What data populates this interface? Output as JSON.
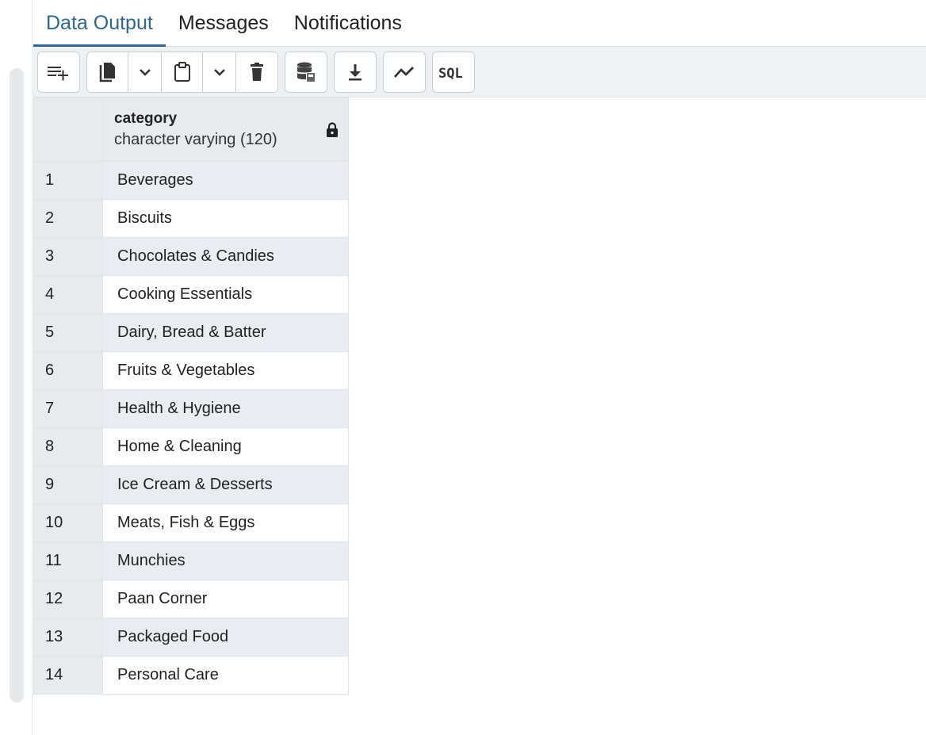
{
  "tabs": [
    {
      "label": "Data Output",
      "active": true
    },
    {
      "label": "Messages",
      "active": false
    },
    {
      "label": "Notifications",
      "active": false
    }
  ],
  "toolbar": {
    "buttons": [
      {
        "icon": "add-row-icon"
      },
      {
        "icon": "copy-icon"
      },
      {
        "icon": "chevron-down-icon"
      },
      {
        "icon": "paste-icon"
      },
      {
        "icon": "chevron-down-icon"
      },
      {
        "icon": "delete-icon"
      },
      {
        "icon": "save-data-icon"
      },
      {
        "icon": "download-icon"
      },
      {
        "icon": "graph-visualiser-icon"
      },
      {
        "icon": "sql-icon",
        "label": "SQL"
      }
    ]
  },
  "grid": {
    "column": {
      "name": "category",
      "type": "character varying (120)",
      "locked": true
    },
    "rows": [
      {
        "num": "1",
        "value": "Beverages"
      },
      {
        "num": "2",
        "value": "Biscuits"
      },
      {
        "num": "3",
        "value": "Chocolates & Candies"
      },
      {
        "num": "4",
        "value": "Cooking Essentials"
      },
      {
        "num": "5",
        "value": "Dairy, Bread & Batter"
      },
      {
        "num": "6",
        "value": "Fruits & Vegetables"
      },
      {
        "num": "7",
        "value": "Health & Hygiene"
      },
      {
        "num": "8",
        "value": "Home & Cleaning"
      },
      {
        "num": "9",
        "value": "Ice Cream & Desserts"
      },
      {
        "num": "10",
        "value": "Meats, Fish & Eggs"
      },
      {
        "num": "11",
        "value": "Munchies"
      },
      {
        "num": "12",
        "value": "Paan Corner"
      },
      {
        "num": "13",
        "value": "Packaged Food"
      },
      {
        "num": "14",
        "value": "Personal Care"
      }
    ]
  },
  "colors": {
    "accent": "#326690",
    "header_bg": "#e8ebee",
    "stripe": "#e9edf1"
  }
}
